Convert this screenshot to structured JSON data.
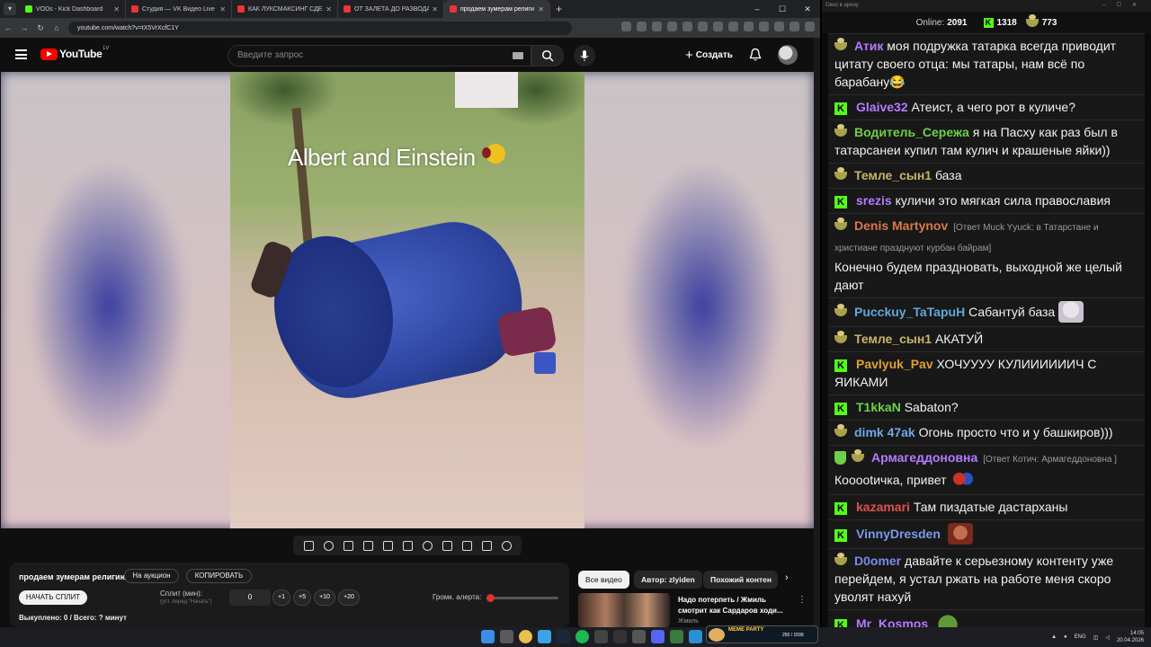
{
  "browser": {
    "tabs": [
      {
        "title": "VODs - Kick Dashboard",
        "color": "#53fc18"
      },
      {
        "title": "Студия — VK Видео Live",
        "color": "#e33"
      },
      {
        "title": "КАК ЛУКСМАКСИНГ СДЕЛАЛ",
        "color": "#e33"
      },
      {
        "title": "ОТ ЗАЛЕТА ДО РАЗВОДА: пс",
        "color": "#e33"
      },
      {
        "title": "продаем зумерам религи",
        "color": "#e33"
      }
    ],
    "url": "youtube.com/watch?v=tX5VrXcfC1Y"
  },
  "youtube": {
    "logo_text": "YouTube",
    "country": "LV",
    "search_placeholder": "Введите запрос",
    "create_label": "Создать",
    "video_caption": "Albert and Einstein",
    "video_title": "продаем зумерам религию",
    "auction_btn": "На аукцион",
    "copy_btn": "КОПИРОВАТЬ",
    "start_split_btn": "НАЧАТЬ СПЛИТ",
    "split_label": "Сплит (мин):",
    "split_hint": "(уст. перед \"Начать\")",
    "split_value": "0",
    "steps": [
      "+1",
      "+5",
      "+10",
      "+20"
    ],
    "alert_volume_label": "Громк. алерта:",
    "alert_volume": 0.05,
    "bought_label": "Выкуплено: 0 / Всего: ? минут",
    "chips": [
      "Все видео",
      "Автор: zlyiden",
      "Похожий контен"
    ],
    "rec_title": "Надо потерпеть / Жмиль смотрит как Сардаров ходи...",
    "rec_channel": "Жмиль"
  },
  "chat": {
    "window_title": "Окно в арену",
    "online_label": "Online:",
    "online_value": "2091",
    "kick_count": "1318",
    "other_count": "773",
    "messages": [
      {
        "badge": "bowl",
        "user": "Атик",
        "color": "#b57bff",
        "text": "моя подружка татарка всегда приводит цитату своего отца: мы татары, нам всё по барабану😂",
        "reply": "",
        "emote": ""
      },
      {
        "badge": "kick",
        "user": "Glaive32",
        "color": "#b57bff",
        "text": "Атеист, а чего рот в куличе?",
        "reply": "",
        "emote": ""
      },
      {
        "badge": "bowl",
        "user": "Водитель_Сережа",
        "color": "#6fcf4a",
        "text": "я на Пасху как раз был в татарсанеи купил там кулич и крашеные яйки))",
        "reply": "",
        "emote": ""
      },
      {
        "badge": "bowl",
        "user": "Темле_сын1",
        "color": "#c9b36a",
        "text": "база",
        "reply": "",
        "emote": ""
      },
      {
        "badge": "kick",
        "user": "srezis",
        "color": "#b57bff",
        "text": "куличи это мягкая сила православия",
        "reply": "",
        "emote": ""
      },
      {
        "badge": "bowl",
        "user": "Denis Martynov",
        "color": "#d9784a",
        "text": "Конечно будем праздновать, выходной же целый дают",
        "reply": "[Ответ Muck Yyuck: в Татарстане и христиане празднуют курбан байрам]",
        "emote": ""
      },
      {
        "badge": "bowl",
        "user": "Pucckuy_TaTapuH",
        "color": "#5fa8d8",
        "text": "Сабантуй база",
        "reply": "",
        "emote": "face"
      },
      {
        "badge": "bowl",
        "user": "Темле_сын1",
        "color": "#c9b36a",
        "text": "АКАТУЙ",
        "reply": "",
        "emote": ""
      },
      {
        "badge": "kick",
        "user": "Pavlyuk_Pav",
        "color": "#e0a030",
        "text": "ХОЧУУУУ КУЛИИИИИИЧ С ЯИКАМИ",
        "reply": "",
        "emote": ""
      },
      {
        "badge": "kick",
        "user": "T1kkaN",
        "color": "#6fcf4a",
        "text": "Sabaton?",
        "reply": "",
        "emote": ""
      },
      {
        "badge": "bowl",
        "user": "dimk 47ak",
        "color": "#6fa8e8",
        "text": "Огонь просто что и у башкиров)))",
        "reply": "",
        "emote": ""
      },
      {
        "badge": "shield",
        "user": "Армагеддоновна",
        "color": "#b57bff",
        "text": "Кооootичка, привет",
        "reply": "[Ответ Котич: Армагеддоновна ]",
        "emote": "heart"
      },
      {
        "badge": "kick",
        "user": "kazamari",
        "color": "#e05050",
        "text": "Там пиздатые дастарханы",
        "reply": "",
        "emote": ""
      },
      {
        "badge": "kick",
        "user": "VinnyDresden",
        "color": "#7a9ae8",
        "text": "",
        "reply": "",
        "emote": "man"
      },
      {
        "badge": "bowl",
        "user": "D0omer",
        "color": "#7a8ae8",
        "text": "давайте к серьезному контенту уже перейдем, я устал ржать на работе меня скоро уволят нахуй",
        "reply": "",
        "emote": ""
      },
      {
        "badge": "kick",
        "user": "Mr_Kosmos",
        "color": "#b57bff",
        "text": "",
        "reply": "",
        "emote": "pepe"
      }
    ]
  },
  "taskbar": {
    "meme_title": "MEME PARTY",
    "meme_progress": "250 / 1599",
    "lang": "ENG",
    "time": "14:05",
    "date": "20.04.2026"
  }
}
